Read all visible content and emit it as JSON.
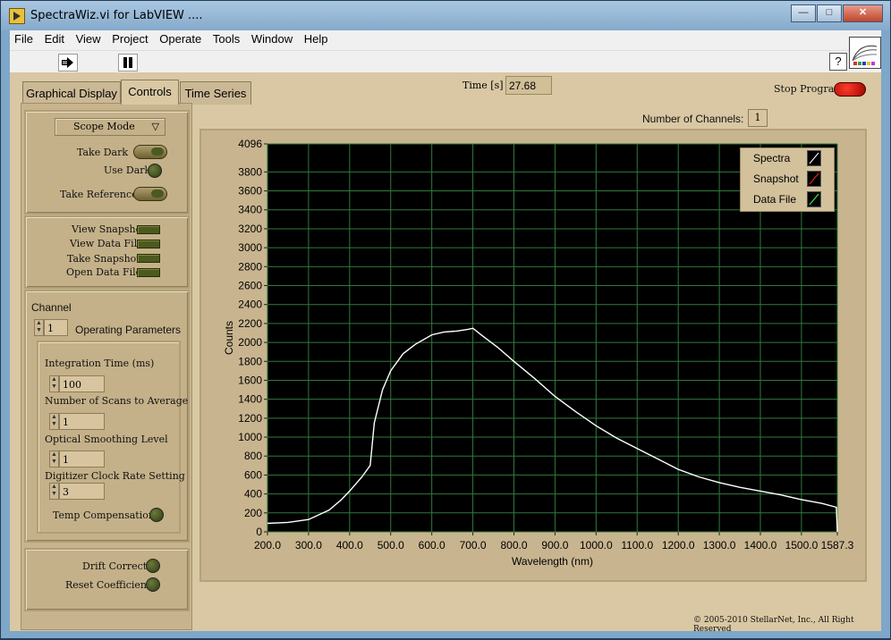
{
  "window": {
    "title": "SpectraWiz.vi for LabVIEW ....",
    "minimize": "—",
    "maximize": "□",
    "close": "✕"
  },
  "menu": [
    "File",
    "Edit",
    "View",
    "Project",
    "Operate",
    "Tools",
    "Window",
    "Help"
  ],
  "toolbar": {
    "run_icon": "run-continuously-icon",
    "pause_icon": "pause-icon",
    "help_label": "?"
  },
  "tabs": [
    "Graphical Display",
    "Controls",
    "Time Series"
  ],
  "active_tab": "Controls",
  "header": {
    "time_label": "Time [s]",
    "time_value": "27.68",
    "stop_label": "Stop Program",
    "channels_label": "Number of Channels:",
    "channels_value": "1"
  },
  "controls": {
    "mode": "Scope Mode",
    "take_dark": "Take Dark",
    "use_dark": "Use Dark",
    "take_reference": "Take Reference",
    "view_snapshot": "View Snapshot",
    "view_data_file": "View Data File",
    "take_snapshot": "Take Snapshot",
    "open_data_file": "Open Data File",
    "channel_label": "Channel",
    "channel_value": "1",
    "operating_parameters": "Operating Parameters",
    "integration_label": "Integration Time (ms)",
    "integration_value": "100",
    "scans_label": "Number of Scans to Average",
    "scans_value": "1",
    "smoothing_label": "Optical Smoothing Level",
    "smoothing_value": "1",
    "clock_label": "Digitizer Clock Rate Setting",
    "clock_value": "3",
    "temp_comp": "Temp  Compensation",
    "drift_correct": "Drift Correct",
    "reset_coeff": "Reset Coefficients"
  },
  "copyright": "© 2005-2010 StellarNet, Inc.,  All Right Reserved",
  "chart_data": {
    "type": "line",
    "xlabel": "Wavelength (nm)",
    "ylabel": "Counts",
    "xlim": [
      200,
      1587.3
    ],
    "ylim": [
      0,
      4096
    ],
    "x_ticks": [
      "200.0",
      "300.0",
      "400.0",
      "500.0",
      "600.0",
      "700.0",
      "800.0",
      "900.0",
      "1000.0",
      "1100.0",
      "1200.0",
      "1300.0",
      "1400.0",
      "1500.0",
      "1587.3"
    ],
    "y_ticks": [
      "0",
      "200",
      "400",
      "600",
      "800",
      "1000",
      "1200",
      "1400",
      "1600",
      "1800",
      "2000",
      "2200",
      "2400",
      "2600",
      "2800",
      "3000",
      "3200",
      "3400",
      "3600",
      "3800",
      "4096"
    ],
    "grid": true,
    "legend_position": "top-right",
    "legend": [
      "Spectra",
      "Snapshot",
      "Data File"
    ],
    "series": [
      {
        "name": "Spectra",
        "color": "#ffffff",
        "x": [
          200,
          250,
          300,
          350,
          380,
          400,
          430,
          450,
          460,
          480,
          500,
          530,
          560,
          600,
          630,
          660,
          690,
          700,
          720,
          760,
          800,
          850,
          900,
          950,
          1000,
          1050,
          1100,
          1150,
          1200,
          1250,
          1300,
          1350,
          1400,
          1450,
          1500,
          1550,
          1585,
          1587.3
        ],
        "y": [
          90,
          100,
          130,
          230,
          340,
          430,
          580,
          700,
          1150,
          1500,
          1700,
          1880,
          1980,
          2080,
          2110,
          2120,
          2140,
          2150,
          2080,
          1950,
          1800,
          1620,
          1430,
          1270,
          1120,
          990,
          880,
          770,
          660,
          580,
          520,
          470,
          430,
          390,
          340,
          300,
          260,
          0
        ]
      }
    ]
  }
}
